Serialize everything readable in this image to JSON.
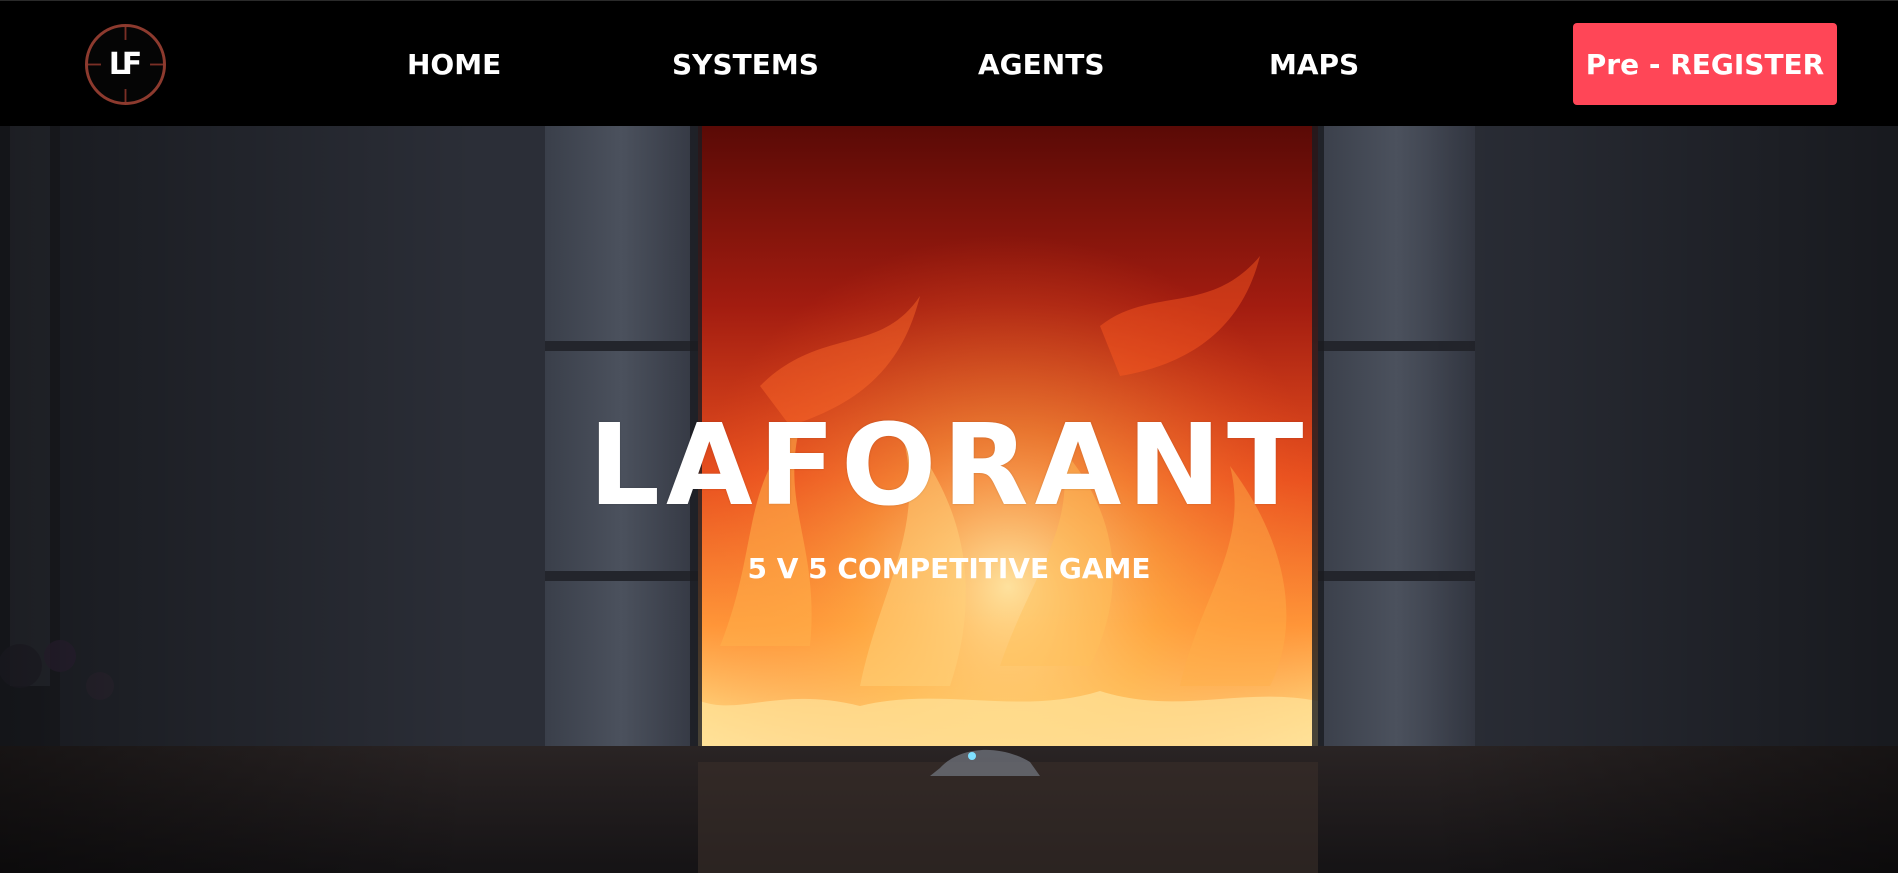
{
  "header": {
    "logo_text": "LF",
    "nav": {
      "home": "HOME",
      "systems": "SYSTEMS",
      "agents": "AGENTS",
      "maps": "MAPS"
    },
    "cta_label": "Pre - REGISTER"
  },
  "hero": {
    "title": "LAFORANT",
    "subtitle": "5 V 5 COMPETITIVE GAME"
  },
  "colors": {
    "nav_bg": "#000000",
    "accent": "#ff4657",
    "fire_core": "#ffd37a",
    "fire_mid": "#e8501f",
    "fire_dark": "#6e0e08",
    "wall": "#2a2d36"
  },
  "icons": [
    "logo-crosshair-icon"
  ]
}
